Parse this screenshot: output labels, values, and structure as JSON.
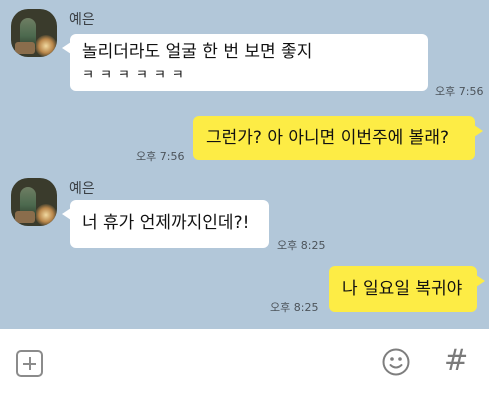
{
  "messages": [
    {
      "sender": "예은",
      "text_line1": "놀리더라도 얼굴 한 번 보면 좋지",
      "text_line2": "ㅋㅋㅋㅋㅋㅋ",
      "time": "오후 7:56"
    },
    {
      "sender": "me",
      "text": "그런가? 아 아니면 이번주에 볼래?",
      "time": "오후 7:56"
    },
    {
      "sender": "예은",
      "text": "너 휴가 언제까지인데?!",
      "time": "오후 8:25"
    },
    {
      "sender": "me",
      "text": "나 일요일 복귀야",
      "time": "오후 8:25"
    }
  ],
  "colors": {
    "chat_background": "#b2c7d9",
    "my_bubble": "#fdec45",
    "their_bubble": "#ffffff"
  },
  "input_bar": {
    "plus_icon": "plus-square-icon",
    "emoji_icon": "smiley-icon",
    "hash_icon": "#"
  }
}
